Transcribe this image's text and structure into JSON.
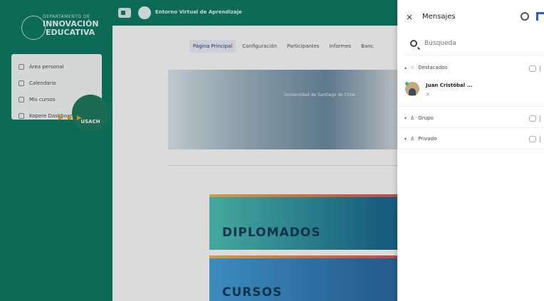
{
  "lms": {
    "logo": {
      "dept": "DEPARTAMENTO DE",
      "main": "INNOVACIÓN",
      "sub": "EDUCATIVA"
    },
    "site_name": "Entorno Virtual de Aprendizaje",
    "nav": [
      {
        "label": "Área personal",
        "icon": "dashboard-icon"
      },
      {
        "label": "Calendario",
        "icon": "calendar-icon"
      },
      {
        "label": "Mis cursos",
        "icon": "courses-icon"
      },
      {
        "label": "Kopere Dashboard",
        "icon": "kopere-icon"
      }
    ],
    "tabs": [
      {
        "label": "Página Principal",
        "active": true
      },
      {
        "label": "Configuración",
        "active": false
      },
      {
        "label": "Participantes",
        "active": false
      },
      {
        "label": "Informes",
        "active": false
      },
      {
        "label": "Banc",
        "active": false
      }
    ],
    "banner_sign": "Universidad de Santiago de Chile",
    "usach": "USACH",
    "cards": [
      "DIPLOMADOS",
      "CURSOS"
    ],
    "colors": {
      "brand_green": "#0e7a63",
      "accent": "#2a5bd7"
    }
  },
  "drawer": {
    "close_label": "×",
    "title": "Mensajes",
    "search": {
      "placeholder": "Búsqueda",
      "value": ""
    },
    "sections": [
      {
        "label": "Destacados",
        "icon": "star-icon",
        "chev": "▴"
      },
      {
        "label": "Grupo",
        "icon": "group-icon",
        "chev": "▾"
      },
      {
        "label": "Privado",
        "icon": "user-icon",
        "chev": "▾"
      }
    ],
    "starred_contact": {
      "name": "Juan Cristóbal ...",
      "meta": "✕"
    }
  }
}
